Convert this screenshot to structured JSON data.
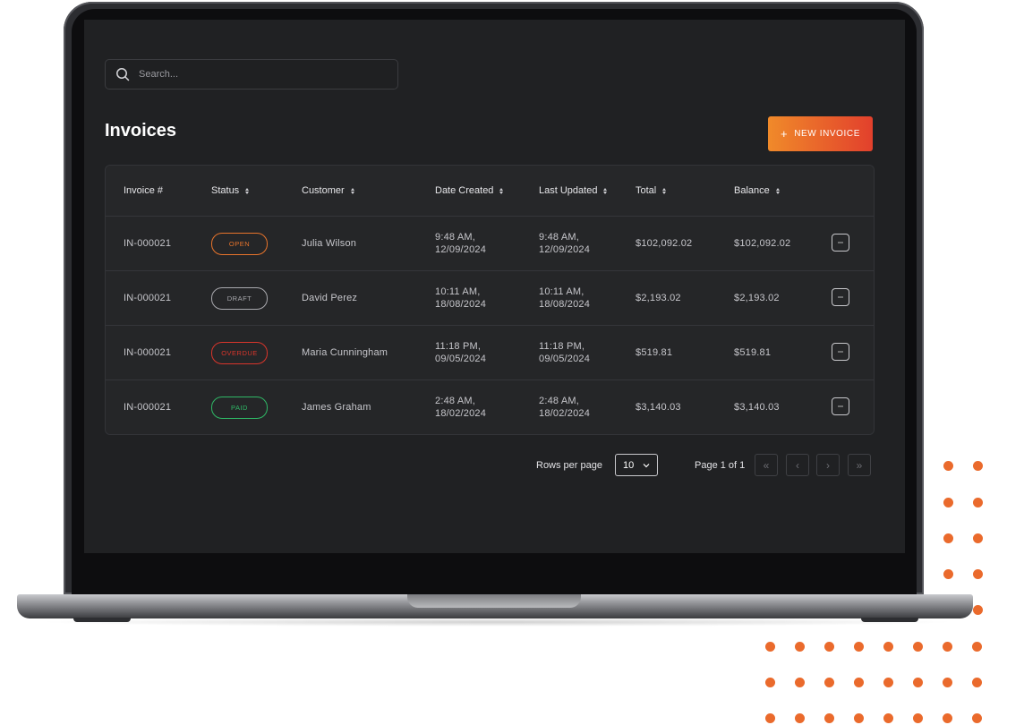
{
  "search": {
    "placeholder": "Search..."
  },
  "page": {
    "title": "Invoices"
  },
  "actions": {
    "new_invoice_label": "NEW INVOICE",
    "new_invoice_icon": "plus-icon"
  },
  "table": {
    "columns": [
      "Invoice #",
      "Status",
      "Customer",
      "Date Created",
      "Last Updated",
      "Total",
      "Balance"
    ],
    "sortable": [
      false,
      true,
      true,
      true,
      true,
      true,
      true
    ],
    "rows": [
      {
        "invoice": "IN-000021",
        "status": "OPEN",
        "customer": "Julia Wilson",
        "created_time": "9:48 AM,",
        "created_date": "12/09/2024",
        "updated_time": "9:48 AM,",
        "updated_date": "12/09/2024",
        "total": "$102,092.02",
        "balance": "$102,092.02"
      },
      {
        "invoice": "IN-000021",
        "status": "DRAFT",
        "customer": "David Perez",
        "created_time": "10:11 AM,",
        "created_date": "18/08/2024",
        "updated_time": "10:11 AM,",
        "updated_date": "18/08/2024",
        "total": "$2,193.02",
        "balance": "$2,193.02"
      },
      {
        "invoice": "IN-000021",
        "status": "OVERDUE",
        "customer": "Maria Cunningham",
        "created_time": "11:18 PM,",
        "created_date": "09/05/2024",
        "updated_time": "11:18 PM,",
        "updated_date": "09/05/2024",
        "total": "$519.81",
        "balance": "$519.81"
      },
      {
        "invoice": "IN-000021",
        "status": "PAID",
        "customer": "James Graham",
        "created_time": "2:48 AM,",
        "created_date": "18/02/2024",
        "updated_time": "2:48 AM,",
        "updated_date": "18/02/2024",
        "total": "$3,140.03",
        "balance": "$3,140.03"
      }
    ],
    "row_action_icon": "more-horizontal-icon"
  },
  "status_colors": {
    "OPEN": "#e8742b",
    "DRAFT": "#a9a9ae",
    "OVERDUE": "#d9352b",
    "PAID": "#2fb866"
  },
  "pagination": {
    "rows_per_page_label": "Rows per page",
    "rows_per_page_value": "10",
    "page_info": "Page 1 of 1",
    "first_icon": "«",
    "prev_icon": "‹",
    "next_icon": "›",
    "last_icon": "»"
  },
  "colors": {
    "accent_start": "#f08a2a",
    "accent_end": "#e2402c",
    "screen_bg": "#202123",
    "dots": "#ea6a2c"
  }
}
